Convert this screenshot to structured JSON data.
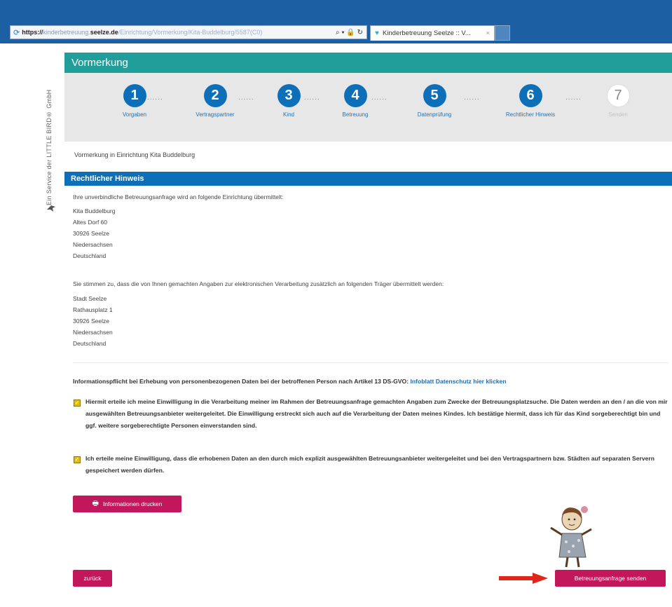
{
  "browser": {
    "url_proto": "https://",
    "url_host": "kinderbetreuung.",
    "url_domain": "seelze.de",
    "url_path": "/Einrichtung/Vormerkung/Kita-Buddelburg/5587(C0)",
    "url_tools": "⌕ ▾ 🔒 ↻",
    "tab_title": "Kinderbetreuung Seelze :: V...",
    "tab_close": "×"
  },
  "side": {
    "vertical_text": "Ein Service der LITTLE BIRD® GmbH"
  },
  "header": {
    "title": "Vormerkung"
  },
  "steps": [
    {
      "num": "1",
      "label": "Vorgaben",
      "active": true
    },
    {
      "num": "2",
      "label": "Vertragspartner",
      "active": true
    },
    {
      "num": "3",
      "label": "Kind",
      "active": true
    },
    {
      "num": "4",
      "label": "Betreuung",
      "active": true
    },
    {
      "num": "5",
      "label": "Datenprüfung",
      "active": true
    },
    {
      "num": "6",
      "label": "Rechtlicher Hinweis",
      "active": true
    },
    {
      "num": "7",
      "label": "Senden",
      "active": false
    }
  ],
  "step_separator": "......",
  "notice": "Vormerkung in Einrichtung Kita Buddelburg",
  "section": {
    "title": "Rechtlicher Hinweis",
    "intro": "Ihre unverbindliche Betreuungsanfrage wird an folgende Einrichtung übermittelt:",
    "address1": [
      "Kita Buddelburg",
      "Altes Dorf 60",
      "30926 Seelze",
      "Niedersachsen",
      "Deutschland"
    ],
    "consent": "Sie stimmen zu, dass die von Ihnen gemachten Angaben zur elektronischen Verarbeitung zusätzlich an folgenden Träger übermittelt werden:",
    "address2": [
      "Stadt Seelze",
      "Rathausplatz 1",
      "30926 Seelze",
      "Niedersachsen",
      "Deutschland"
    ],
    "info_text": "Informationspflicht bei Erhebung von personenbezogenen Daten bei der betroffenen Person nach Artikel 13 DS-GVO:",
    "info_link": "Infoblatt Datenschutz hier klicken",
    "checkbox1": "Hiermit erteile ich meine Einwilligung in die Verarbeitung meiner im Rahmen der Betreuungsanfrage gemachten Angaben zum Zwecke der Betreuungsplatzsuche. Die Daten werden an den / an die von mir ausgewählten Betreuungsanbieter weitergeleitet. Die Einwilligung erstreckt sich auch auf die Verarbeitung der Daten meines Kindes. Ich bestätige hiermit, dass ich für das Kind sorgeberechtigt bin und ggf. weitere sorgeberechtigte Personen einverstanden sind.",
    "checkbox2": "Ich erteile meine Einwilligung, dass die erhobenen Daten an den durch mich explizit ausgewählten Betreuungsanbieter weitergeleitet und bei den Vertragspartnern bzw. Städten auf separaten Servern gespeichert werden dürfen.",
    "checkbox1_checked": true,
    "checkbox2_checked": true
  },
  "buttons": {
    "print": "Informationen drucken",
    "back": "zurück",
    "send": "Betreuungsanfrage senden"
  },
  "icons": {
    "print": "printer-icon",
    "reload": "reload-icon",
    "tab": "heart-icon",
    "logo": "bird-icon"
  },
  "colors": {
    "header": "#1f9e9a",
    "step": "#0d6fb7",
    "button": "#c2185b",
    "checkbox": "#e6c000",
    "arrow": "#e0251b"
  }
}
